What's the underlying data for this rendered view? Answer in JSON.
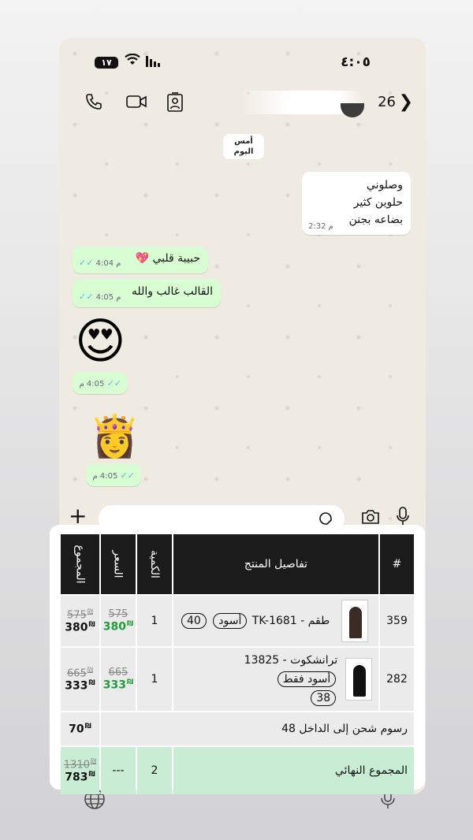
{
  "status_bar": {
    "time": "٤:٠٥",
    "battery": "١٧"
  },
  "chat": {
    "header": {
      "unread_count": "26"
    },
    "date_chip": {
      "line1": "أمس",
      "line2": "اليوم"
    },
    "messages": [
      {
        "id": "m1",
        "dir": "in",
        "lines": [
          "وصلوني",
          "حلوين كثير",
          "بضاعه بجنن"
        ],
        "time": "2:32 م"
      },
      {
        "id": "m2",
        "dir": "out",
        "text": "حبيبة قلبي 💖",
        "time": "4:04 م"
      },
      {
        "id": "m3",
        "dir": "out",
        "text": "القالب غالب والله",
        "time": "4:05 م"
      },
      {
        "id": "m4",
        "dir": "out",
        "emoji": "😍",
        "time": "4:05 م"
      },
      {
        "id": "m5",
        "dir": "out",
        "emoji": "👸",
        "time": "4:05 م"
      }
    ]
  },
  "order_table": {
    "headers": {
      "total": "المجموع",
      "price": "السعر",
      "qty": "الكمية",
      "details": "تفاصيل المنتج",
      "index": "#"
    },
    "currency": "₪",
    "rows": [
      {
        "index": "359",
        "name": "طقم - TK-1681",
        "color": "أسود",
        "size": "40",
        "qty": "1",
        "price_old": "575",
        "price_new": "380",
        "total_old": "575",
        "total_new": "380",
        "thumb_color": "#3a2b24"
      },
      {
        "index": "282",
        "name": "ترانشكوت - 13825",
        "color": "أسود فقط",
        "size": "38",
        "qty": "1",
        "price_old": "665",
        "price_new": "333",
        "total_old": "665",
        "total_new": "333",
        "thumb_color": "#111111"
      }
    ],
    "shipping": {
      "label": "رسوم شحن إلى الداخل 48",
      "amount": "70"
    },
    "grand_total": {
      "label": "المجموع النهائي",
      "qty": "2",
      "price": "---",
      "total_old": "1310",
      "total_new": "783"
    }
  },
  "colors": {
    "accent_green": "#1f9d3a",
    "bubble_out": "#d9fdd3",
    "header_dark": "#1b1b1b"
  }
}
